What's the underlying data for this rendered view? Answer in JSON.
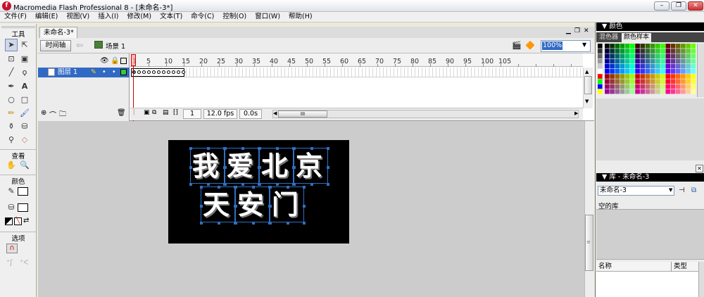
{
  "window": {
    "title": "Macromedia Flash Professional 8 - [未命名-3*]",
    "app_icon": "f"
  },
  "menu": [
    "文件(F)",
    "编辑(E)",
    "视图(V)",
    "插入(I)",
    "修改(M)",
    "文本(T)",
    "命令(C)",
    "控制(O)",
    "窗口(W)",
    "帮助(H)"
  ],
  "toolbox": {
    "tools_label": "工具",
    "view_label": "查看",
    "colors_label": "颜色",
    "options_label": "选项"
  },
  "document": {
    "tab_label": "未命名-3*",
    "timeline_button": "时间轴",
    "scene_label": "场景 1",
    "zoom": "100%"
  },
  "timeline": {
    "ruler_ticks": [
      "1",
      "5",
      "10",
      "15",
      "20",
      "25",
      "30",
      "35",
      "40",
      "45",
      "50",
      "55",
      "60",
      "65",
      "70",
      "75",
      "80",
      "85",
      "90",
      "95",
      "100",
      "105"
    ],
    "layer_name": "图层 1",
    "current_frame": "1",
    "frame_rate": "12.0 fps",
    "elapsed_time": "0.0s",
    "keyframe_marker": "a",
    "keyframe_count": 11,
    "scroll_thumb": "III"
  },
  "stage": {
    "line1": [
      "我",
      "爱",
      "北",
      "京"
    ],
    "line2": [
      "天",
      "安",
      "门"
    ]
  },
  "color_panel": {
    "title": "颜色",
    "tabs": [
      "混色器",
      "颜色样本"
    ],
    "active_tab": 1
  },
  "library_panel": {
    "title": "库 - 未命名-3",
    "document_select": "未命名-3",
    "empty_text": "空的库",
    "columns": [
      "名称",
      "类型"
    ]
  },
  "colors": {
    "selection": "#316ac5",
    "stage": "#000000",
    "pasteboard": "#cccccc",
    "playhead": "#cc0000"
  }
}
